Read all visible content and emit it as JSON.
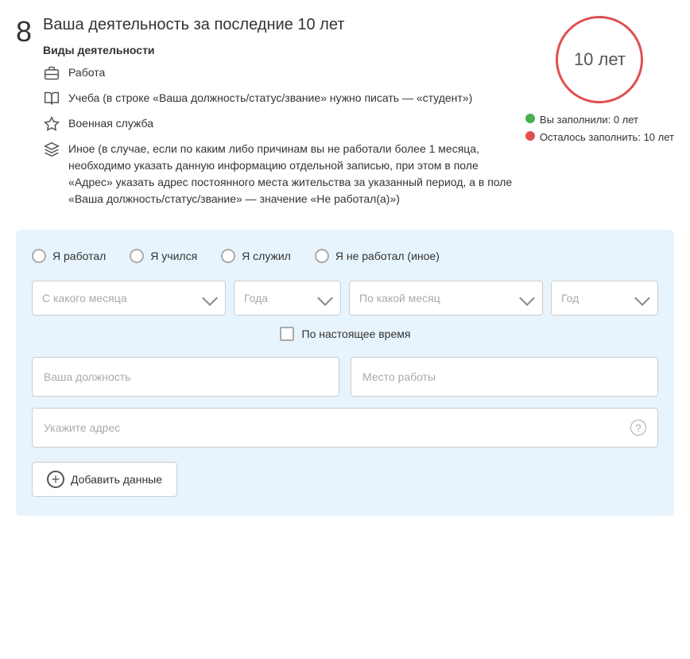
{
  "section": {
    "number": "8",
    "title": "Ваша деятельность за последние 10 лет",
    "activities_title": "Виды деятельности",
    "activities": [
      {
        "id": "work",
        "label": "Работа",
        "icon": "briefcase-icon"
      },
      {
        "id": "study",
        "label": "Учеба (в строке «Ваша должность/статус/звание» нужно писать — «студент»)",
        "icon": "book-icon"
      },
      {
        "id": "military",
        "label": "Военная служба",
        "icon": "star-icon"
      },
      {
        "id": "other",
        "label": "Иное (в случае, если по каким либо причинам вы не работали более 1 месяца, необходимо указать данную информацию отдельной записью, при этом в поле «Адрес» указать адрес постоянного места жительства за указанный период, а в поле «Ваша должность/статус/звание» — значение «Не работал(а)»)",
        "icon": "layers-icon"
      }
    ]
  },
  "progress": {
    "circle_label": "10 лет",
    "filled_label": "Вы заполнили:",
    "filled_value": "0 лет",
    "remaining_label": "Осталось заполнить:",
    "remaining_value": "10 лет"
  },
  "form": {
    "radio_options": [
      {
        "id": "worked",
        "label": "Я работал"
      },
      {
        "id": "studied",
        "label": "Я учился"
      },
      {
        "id": "served",
        "label": "Я служил"
      },
      {
        "id": "not_worked",
        "label": "Я не работал (иное)"
      }
    ],
    "from_month_placeholder": "С какого месяца",
    "from_year_placeholder": "Года",
    "to_month_placeholder": "По какой месяц",
    "to_year_placeholder": "Год",
    "present_checkbox_label": "По настоящее время",
    "position_placeholder": "Ваша должность",
    "workplace_placeholder": "Место работы",
    "address_placeholder": "Укажите адрес",
    "add_button_label": "Добавить данные",
    "question_mark": "?"
  }
}
